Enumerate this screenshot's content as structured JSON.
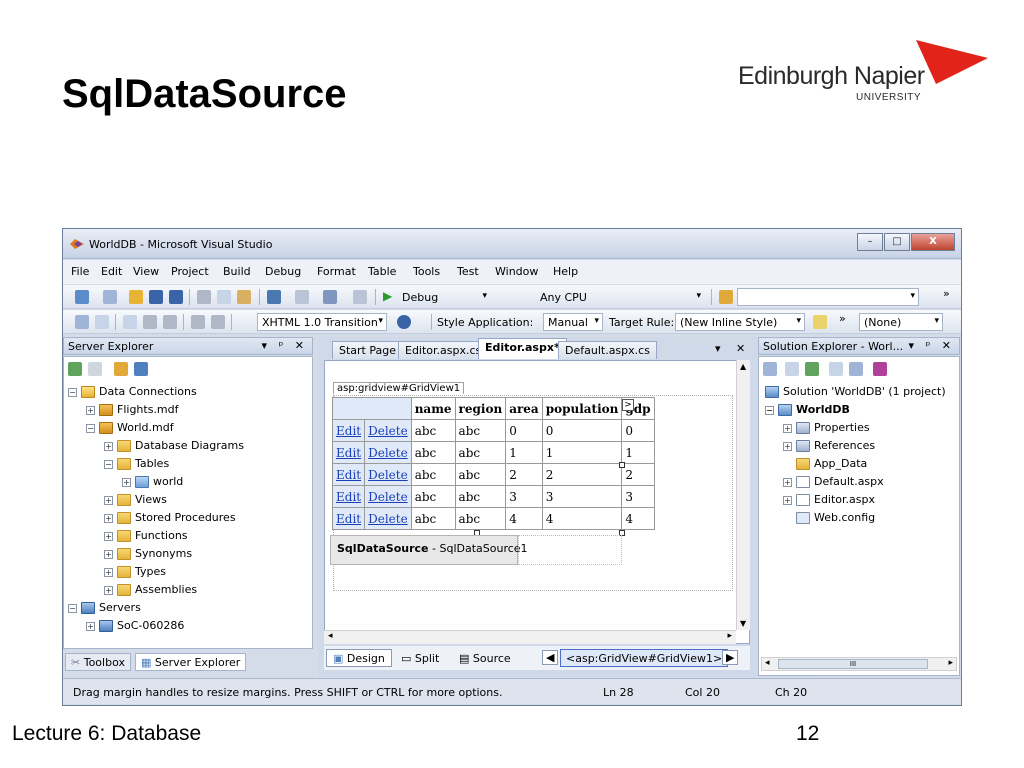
{
  "slide": {
    "title": "SqlDataSource",
    "footer_left": "Lecture 6: Database",
    "page_number": "12",
    "logo_name": "Edinburgh Napier",
    "logo_university": "UNIVERSITY",
    "accent_color": "#e2231a"
  },
  "window": {
    "title": "WorldDB - Microsoft Visual Studio",
    "minimize": "–",
    "maximize": "□",
    "close": "X"
  },
  "menu": [
    "File",
    "Edit",
    "View",
    "Project",
    "Build",
    "Debug",
    "Format",
    "Table",
    "Tools",
    "Test",
    "Window",
    "Help"
  ],
  "toolbar1": {
    "run_label": "▶",
    "config": "Debug",
    "platform": "Any CPU"
  },
  "toolbar2": {
    "doctype": "XHTML 1.0 Transition",
    "style_application_label": "Style Application:",
    "style_application_value": "Manual",
    "target_rule_label": "Target Rule:",
    "target_rule_value": "(New Inline Style)",
    "style_value": "(None)"
  },
  "server_explorer": {
    "title": "Server Explorer",
    "header_buttons": "▾ ᵖ ✕",
    "nodes": [
      {
        "label": "Data Connections"
      },
      {
        "label": "Flights.mdf"
      },
      {
        "label": "World.mdf"
      },
      {
        "label": "Database Diagrams"
      },
      {
        "label": "Tables"
      },
      {
        "label": "world"
      },
      {
        "label": "Views"
      },
      {
        "label": "Stored Procedures"
      },
      {
        "label": "Functions"
      },
      {
        "label": "Synonyms"
      },
      {
        "label": "Types"
      },
      {
        "label": "Assemblies"
      },
      {
        "label": "Servers"
      },
      {
        "label": "SoC-060286"
      }
    ],
    "tabs": {
      "toolbox": "Toolbox",
      "server_explorer": "Server Explorer"
    }
  },
  "documents": {
    "tabs": [
      "Start Page",
      "Editor.aspx.cs",
      "Editor.aspx*",
      "Default.aspx.cs"
    ],
    "active_tab": "Editor.aspx*",
    "close_buttons": "▾ ✕"
  },
  "designer": {
    "tag_label": "asp:gridview#GridView1",
    "grid": {
      "columns": [
        "name",
        "region",
        "area",
        "population",
        "gdp"
      ],
      "edit_label": "Edit",
      "delete_label": "Delete",
      "rows": [
        [
          "abc",
          "abc",
          "0",
          "0",
          "0"
        ],
        [
          "abc",
          "abc",
          "1",
          "1",
          "1"
        ],
        [
          "abc",
          "abc",
          "2",
          "2",
          "2"
        ],
        [
          "abc",
          "abc",
          "3",
          "3",
          "3"
        ],
        [
          "abc",
          "abc",
          "4",
          "4",
          "4"
        ]
      ]
    },
    "smart_tag": ">",
    "datasource_type": "SqlDataSource",
    "datasource_name": " - SqlDataSource1"
  },
  "view_bar": {
    "design": "Design",
    "split": "Split",
    "source": "Source",
    "path": "<asp:GridView#GridView1>"
  },
  "solution_explorer": {
    "title": "Solution Explorer - Worl...",
    "header_buttons": "▾ ᵖ ✕",
    "nodes": [
      {
        "label": "Solution 'WorldDB' (1 project)"
      },
      {
        "label": "WorldDB"
      },
      {
        "label": "Properties"
      },
      {
        "label": "References"
      },
      {
        "label": "App_Data"
      },
      {
        "label": "Default.aspx"
      },
      {
        "label": "Editor.aspx"
      },
      {
        "label": "Web.config"
      }
    ],
    "scroll_thumb": "III"
  },
  "status": {
    "message": "Drag margin handles to resize margins. Press SHIFT or CTRL for more options.",
    "ln": "Ln 28",
    "col": "Col 20",
    "ch": "Ch 20"
  }
}
